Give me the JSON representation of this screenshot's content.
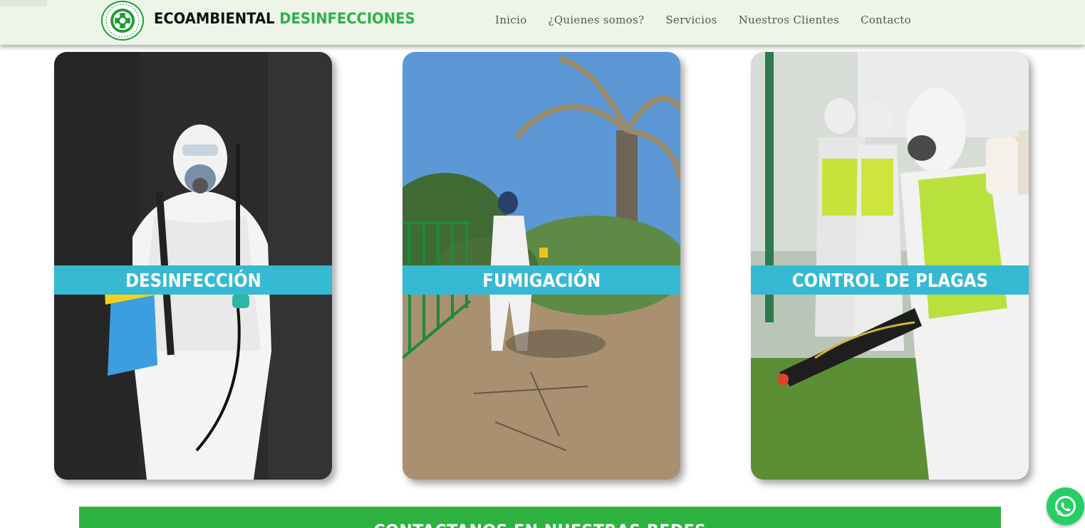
{
  "header": {
    "brand_part1": "ECOAMBIENTAL",
    "brand_part2": "DESINFECCIONES",
    "nav": [
      "Inicio",
      "¿Quienes somos?",
      "Servicios",
      "Nuestros Clientes",
      "Contacto"
    ]
  },
  "services": [
    {
      "label": "DESINFECCIÓN"
    },
    {
      "label": "FUMIGACIÓN"
    },
    {
      "label": "CONTROL DE PLAGAS"
    }
  ],
  "cta": {
    "label": "CONTACTANOS EN NUESTRAS REDES"
  },
  "colors": {
    "header_bg": "#edf5e8",
    "brand_green": "#2fb14a",
    "label_bg": "#36b9d2",
    "cta_bg": "#2eb23f",
    "whatsapp_bg": "#25cf64"
  },
  "icons": {
    "logo": "globe-leaf-icon",
    "whatsapp": "whatsapp-icon"
  }
}
